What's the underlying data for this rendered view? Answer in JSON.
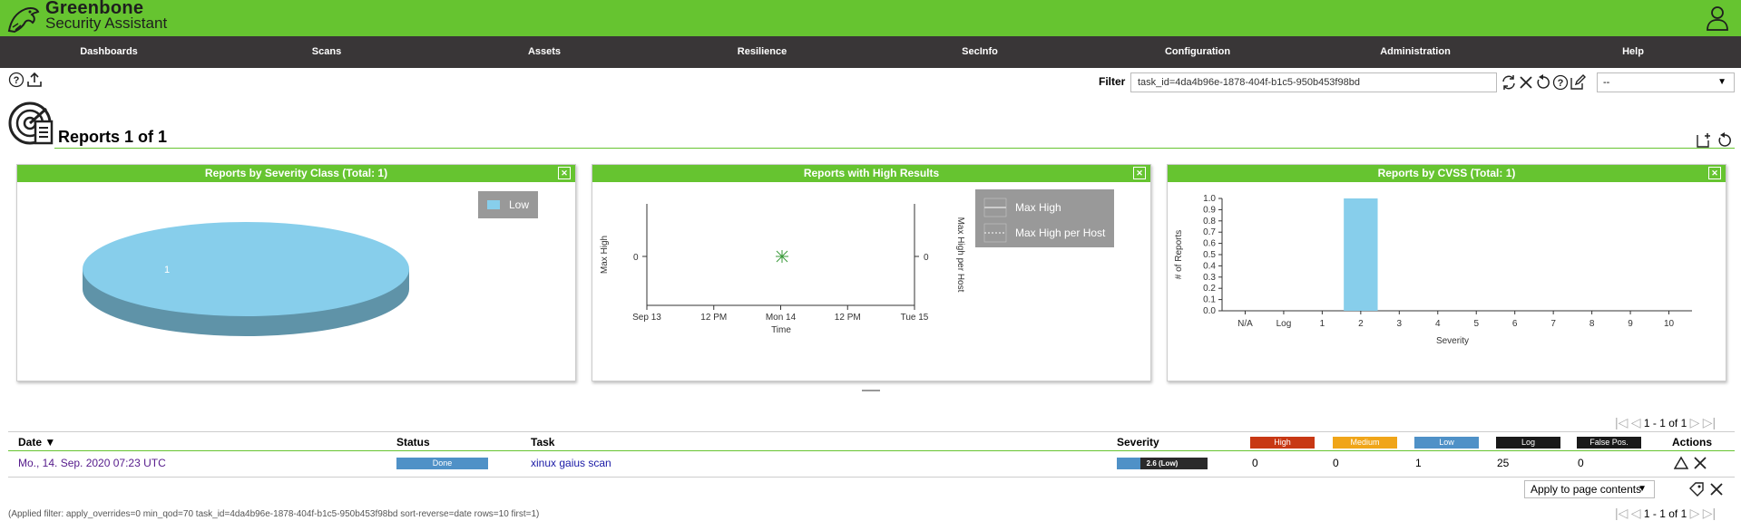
{
  "app": {
    "brand_line1": "Greenbone",
    "brand_line2": "Security Assistant",
    "brand_color": "#66c430"
  },
  "menu": [
    {
      "label": "Dashboards"
    },
    {
      "label": "Scans"
    },
    {
      "label": "Assets"
    },
    {
      "label": "Resilience"
    },
    {
      "label": "SecInfo"
    },
    {
      "label": "Configuration"
    },
    {
      "label": "Administration"
    },
    {
      "label": "Help"
    }
  ],
  "toolbar": {
    "help_icon": "help-icon",
    "upload_icon": "upload-icon"
  },
  "filter": {
    "label": "Filter",
    "value": "task_id=4da4b96e-1878-404f-b1c5-950b453f98bd",
    "select_value": "--"
  },
  "page": {
    "title": "Reports 1 of 1"
  },
  "panels": {
    "severity_class": {
      "title": "Reports by Severity Class (Total: 1)",
      "legend": "Low",
      "slice_label": "1"
    },
    "high_results": {
      "title": "Reports with High Results",
      "legend_max_high": "Max High",
      "legend_max_high_per_host": "Max High per Host",
      "ylabel_left": "Max High",
      "ylabel_right": "Max High per Host",
      "xlabel": "Time",
      "y_tick_left": "0",
      "y_tick_right": "0",
      "x_ticks": [
        "Sep 13",
        "12 PM",
        "Mon 14",
        "12 PM",
        "Tue 15"
      ]
    },
    "cvss": {
      "title": "Reports by CVSS (Total: 1)",
      "ylabel": "# of Reports",
      "xlabel": "Severity"
    }
  },
  "chart_data": [
    {
      "type": "pie",
      "title": "Reports by Severity Class (Total: 1)",
      "categories": [
        "Low"
      ],
      "values": [
        1
      ],
      "colors": [
        "#87ceeb"
      ],
      "legend_placement": "top-right"
    },
    {
      "type": "line",
      "title": "Reports with High Results",
      "xlabel": "Time",
      "ylabel": "Max High",
      "ylabel_right": "Max High per Host",
      "x_ticks": [
        "Sep 13",
        "12 PM",
        "Mon 14",
        "12 PM",
        "Tue 15"
      ],
      "series": [
        {
          "name": "Max High",
          "x": [
            "Mon 14"
          ],
          "values": [
            0
          ]
        },
        {
          "name": "Max High per Host",
          "x": [
            "Mon 14"
          ],
          "values": [
            0
          ]
        }
      ],
      "legend_placement": "top-right"
    },
    {
      "type": "bar",
      "title": "Reports by CVSS (Total: 1)",
      "xlabel": "Severity",
      "ylabel": "# of Reports",
      "categories": [
        "N/A",
        "Log",
        "1",
        "2",
        "3",
        "4",
        "5",
        "6",
        "7",
        "8",
        "9",
        "10"
      ],
      "values": [
        0,
        0,
        0,
        1,
        0,
        0,
        0,
        0,
        0,
        0,
        0,
        0
      ],
      "y_ticks": [
        "0.0",
        "0.1",
        "0.2",
        "0.3",
        "0.4",
        "0.5",
        "0.6",
        "0.7",
        "0.8",
        "0.9",
        "1.0"
      ],
      "ylim": [
        0,
        1.0
      ],
      "bar_color": "#87ceeb"
    }
  ],
  "pagination": {
    "text": "1 - 1 of 1"
  },
  "table": {
    "headers": {
      "date": "Date ▼",
      "status": "Status",
      "task": "Task",
      "severity": "Severity",
      "high": "High",
      "medium": "Medium",
      "low": "Low",
      "log": "Log",
      "false_pos": "False Pos.",
      "actions": "Actions"
    },
    "header_colors": {
      "high": "#c83814",
      "medium": "#f0a519",
      "low": "#4f91c7",
      "log": "#191919",
      "false_pos": "#191919"
    },
    "rows": [
      {
        "date": "Mo., 14. Sep. 2020 07:23 UTC",
        "status": "Done",
        "status_progress": 1.0,
        "task": "xinux gaius scan",
        "severity": "2.6 (Low)",
        "severity_score": 2.6,
        "high": "0",
        "medium": "0",
        "low": "1",
        "log": "25",
        "false_pos": "0"
      }
    ],
    "bulk_action": "Apply to page contents"
  },
  "applied_filter": "(Applied filter: apply_overrides=0 min_qod=70 task_id=4da4b96e-1878-404f-b1c5-950b453f98bd sort-reverse=date rows=10 first=1)"
}
